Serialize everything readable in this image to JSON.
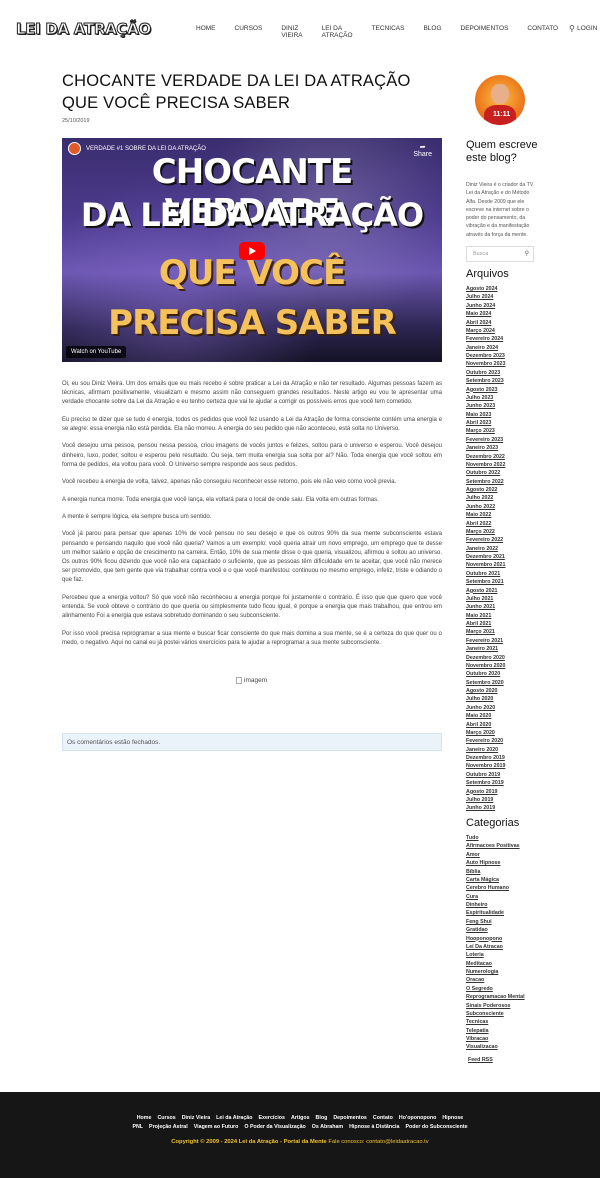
{
  "header": {
    "logo": "LEI DA ATRAÇÃO",
    "nav": [
      "Home",
      "CURSOS",
      "DINIZ VIEIRA",
      "LEI DA ATRAÇÃO",
      "TECNICAS",
      "BLOG",
      "DEPOIMENTOS",
      "CONTATO",
      "LOGIN"
    ],
    "search_icon": "search-icon"
  },
  "post": {
    "title": "CHOCANTE VERDADE DA LEI DA ATRAÇÃO QUE VOCÊ PRECISA SABER",
    "date": "25/10/2019",
    "video": {
      "title": "VERDADE #1 SOBRE DA LEI DA ATRAÇÃO",
      "share_label": "Share",
      "line1": "CHOCANTE VERDADE",
      "line2": "DA LEI DA ATRAÇÃO",
      "line3": "QUE VOCÊ",
      "line4": "PRECISA SABER",
      "watch_label": "Watch on YouTube"
    },
    "paragraphs": [
      "Oi, eu sou Diniz Vieira. Um dos emails que eu mais recebo é sobre praticar a Lei da Atração e não ter resultado. Algumas pessoas fazem as técnicas, afirmam positivamente, visualizam e mesmo assim não conseguem grandes resultados. Neste artigo eu vou te apresentar uma verdade chocante sobre da Lei da Atração e eu tenho certeza que vai te ajudar a corrigir os possíveis erros que você tem cometido.",
      "Eu preciso te dizer que se tudo é energia, todos os pedidos que você fez usando a Lei da Atração de forma consciente contém uma energia e se alegre: essa energia não está perdida. Ela não morreu. A energia do seu pedido que não aconteceu, está solta no Universo.",
      "Você desejou uma pessoa, pensou nessa pessoa, criou imagens de vocês juntos e felizes, soltou para o universo e esperou. Você desejou dinheiro, luxo, poder, soltou e esperou pelo resultado. Ou seja, tem muita energia sua solta por aí? Não. Toda energia que você soltou em forma de pedidos, ela voltou para você. O Universo sempre responde aos seus pedidos.",
      "Você recebeu a energia de volta, talvez, apenas não conseguiu reconhecer esse retorno, pois ele não veio como você previa.",
      "A energia nunca morre. Toda energia que você lança, ela voltará para o local de onde saiu. Ela volta em outras formas.",
      "A mente é sempre lógica, ela sempre busca um sentido.",
      "Você já parou para pensar que apenas 10% de você pensou no seu desejo e que os outros 90% da sua mente subconsciente estava pensando e pensando naquilo que você não queria? Vamos a um exemplo: você queria atrair um novo emprego, um emprego que te desse um melhor salário e opção de crescimento na carreira. Então, 10% de sua mente disse o que queria, visualizou, afirmou e soltou ao universo. Os outros 90% ficou dizendo que você não era capacitado o suficiente, que as pessoas têm dificuldade em te aceitar, que você não merece ser promovido, que tem gente que via trabalhar contra você e o que você manifestou: continuou no mesmo emprego, infeliz, triste e odiando o que faz.",
      "Percebeu que a energia voltou? Só que você não reconheceu a energia porque foi justamente o contrário. É isso que que quero que você entenda. Se você obteve o contrário do que queria ou simplesmente tudo ficou igual, é porque a energia que mais trabalhou, que entrou em alinhamento Foi a energia que estava sobretudo dominando o seu subconsciente.",
      "Por isso você precisa reprogramar a sua mente e buscar ficar consciente do que mais domina a sua mente, se é a certeza do que quer ou o medo, o negativo. Aqui no canal eu já postei vários exercícios para te ajudar a reprogramar a sua mente subconsciente."
    ],
    "image_alt": "imagem",
    "comments_closed": "Os comentários estão fechados."
  },
  "sidebar": {
    "about_title": "Quem escreve este blog?",
    "about_text": "Diniz Vieira é o criador da TV Lei da Atração e do Método Alfa. Desde 2009 que ele escreve na internet sobre o poder do pensamento, da vibração e da manifestação através da força da mente.",
    "search_placeholder": "Busca",
    "archives_title": "Arquivos",
    "archives": [
      "Agosto 2024",
      "Julho 2024",
      "Junho 2024",
      "Maio 2024",
      "Abril 2024",
      "Março 2024",
      "Fevereiro 2024",
      "Janeiro 2024",
      "Dezembro 2023",
      "Novembro 2023",
      "Outubro 2023",
      "Setembro 2023",
      "Agosto 2023",
      "Julho 2023",
      "Junho 2023",
      "Maio 2023",
      "Abril 2023",
      "Março 2023",
      "Fevereiro 2023",
      "Janeiro 2023",
      "Dezembro 2022",
      "Novembro 2022",
      "Outubro 2022",
      "Setembro 2022",
      "Agosto 2022",
      "Julho 2022",
      "Junho 2022",
      "Maio 2022",
      "Abril 2022",
      "Março 2022",
      "Fevereiro 2022",
      "Janeiro 2022",
      "Dezembro 2021",
      "Novembro 2021",
      "Outubro 2021",
      "Setembro 2021",
      "Agosto 2021",
      "Julho 2021",
      "Junho 2021",
      "Maio 2021",
      "Abril 2021",
      "Março 2021",
      "Fevereiro 2021",
      "Janeiro 2021",
      "Dezembro 2020",
      "Novembro 2020",
      "Outubro 2020",
      "Setembro 2020",
      "Agosto 2020",
      "Julho 2020",
      "Junho 2020",
      "Maio 2020",
      "Abril 2020",
      "Março 2020",
      "Fevereiro 2020",
      "Janeiro 2020",
      "Dezembro 2019",
      "Novembro 2019",
      "Outubro 2019",
      "Setembro 2019",
      "Agosto 2019",
      "Julho 2019",
      "Junho 2019"
    ],
    "categories_title": "Categorias",
    "categories": [
      "Tudo",
      "Afirmacoes Positivas",
      "Amor",
      "Auto Hipnose",
      "Bíblia",
      "Carta Mágica",
      "Cerebro Humano",
      "Cura",
      "Dinheiro",
      "Espiritualidade",
      "Feng Shui",
      "Gratidao",
      "Hooponopono",
      "Lei Da Atracao",
      "Loteria",
      "Meditacao",
      "Numerologia",
      "Oracao",
      "O Segredo",
      "Reprogramacao Mental",
      "Sinais Poderosos",
      "Subconsciente",
      "Tecnicas",
      "Telepatia",
      "Vibracao",
      "Visualizacao"
    ],
    "feed": "Feed RSS"
  },
  "footer": {
    "row1": [
      "Home",
      "Cursos",
      "Diniz Vieira",
      "Lei da Atração",
      "Exercícios",
      "Artigos",
      "Blog",
      "Depoimentos",
      "Contato",
      "Ho'oponopono",
      "Hipnose"
    ],
    "row2": [
      "PNL",
      "Projeção Astral",
      "Viagem ao Futuro",
      "O Poder da Visualização",
      "Os Abraham",
      "Hipnose à Distância",
      "Poder do Subconsciente"
    ],
    "copyright": "Copyright © 2009 - 2024 Lei da Atração - Portal da Mente",
    "contact": "Fale conosco: contato@leidaatracao.tv"
  },
  "colors": {
    "footer_bg": "#161616",
    "footer_accent": "#f1c232",
    "comment_bg": "#eaf2fa"
  }
}
